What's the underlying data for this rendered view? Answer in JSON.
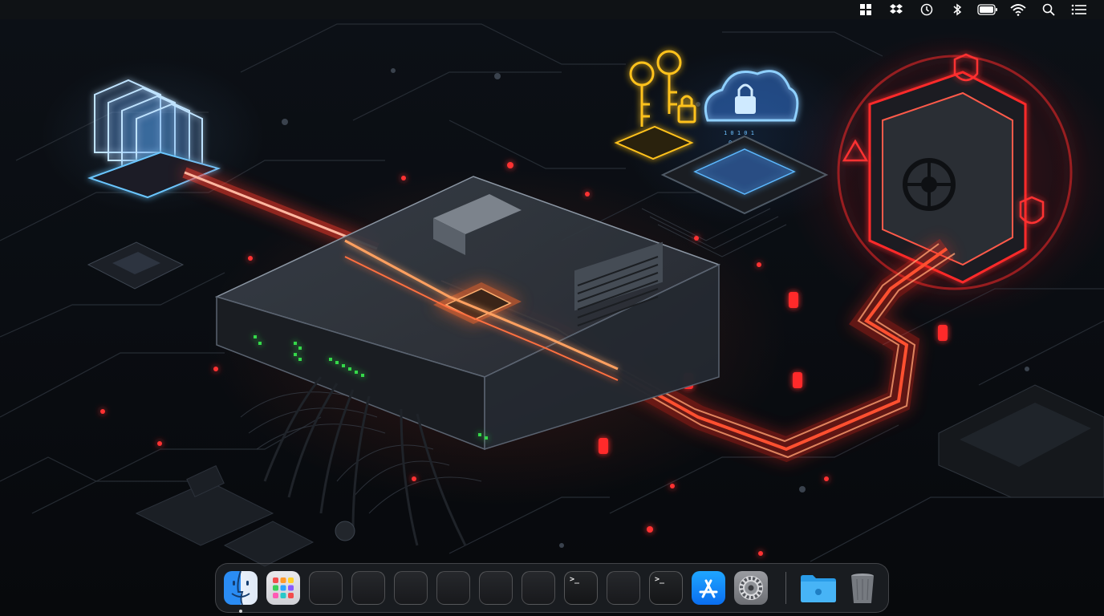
{
  "screen": {
    "wallpaper": "cybersecurity-network-server-wallpaper",
    "accent_colors": {
      "red_glow": "#ff2a2a",
      "blue_glow": "#5cb8ff",
      "gold_glow": "#ffc21a",
      "green_led": "#34d84a"
    }
  },
  "menubar": {
    "status_items": [
      {
        "name": "window-grid-icon"
      },
      {
        "name": "dropbox-icon"
      },
      {
        "name": "clock-icon"
      },
      {
        "name": "bluetooth-icon"
      },
      {
        "name": "battery-icon"
      },
      {
        "name": "wifi-icon"
      },
      {
        "name": "spotlight-search-icon"
      },
      {
        "name": "control-center-icon"
      }
    ]
  },
  "dock": {
    "items": [
      {
        "name": "finder",
        "running": true
      },
      {
        "name": "launchpad"
      },
      {
        "name": "app-empty"
      },
      {
        "name": "app-empty"
      },
      {
        "name": "app-empty"
      },
      {
        "name": "app-empty"
      },
      {
        "name": "app-empty"
      },
      {
        "name": "app-empty"
      },
      {
        "name": "terminal",
        "prompt": ">_"
      },
      {
        "name": "app-empty"
      },
      {
        "name": "terminal",
        "prompt": ">_"
      },
      {
        "name": "app-store"
      },
      {
        "name": "system-settings"
      },
      {
        "name": "downloads-folder"
      },
      {
        "name": "trash"
      }
    ]
  }
}
